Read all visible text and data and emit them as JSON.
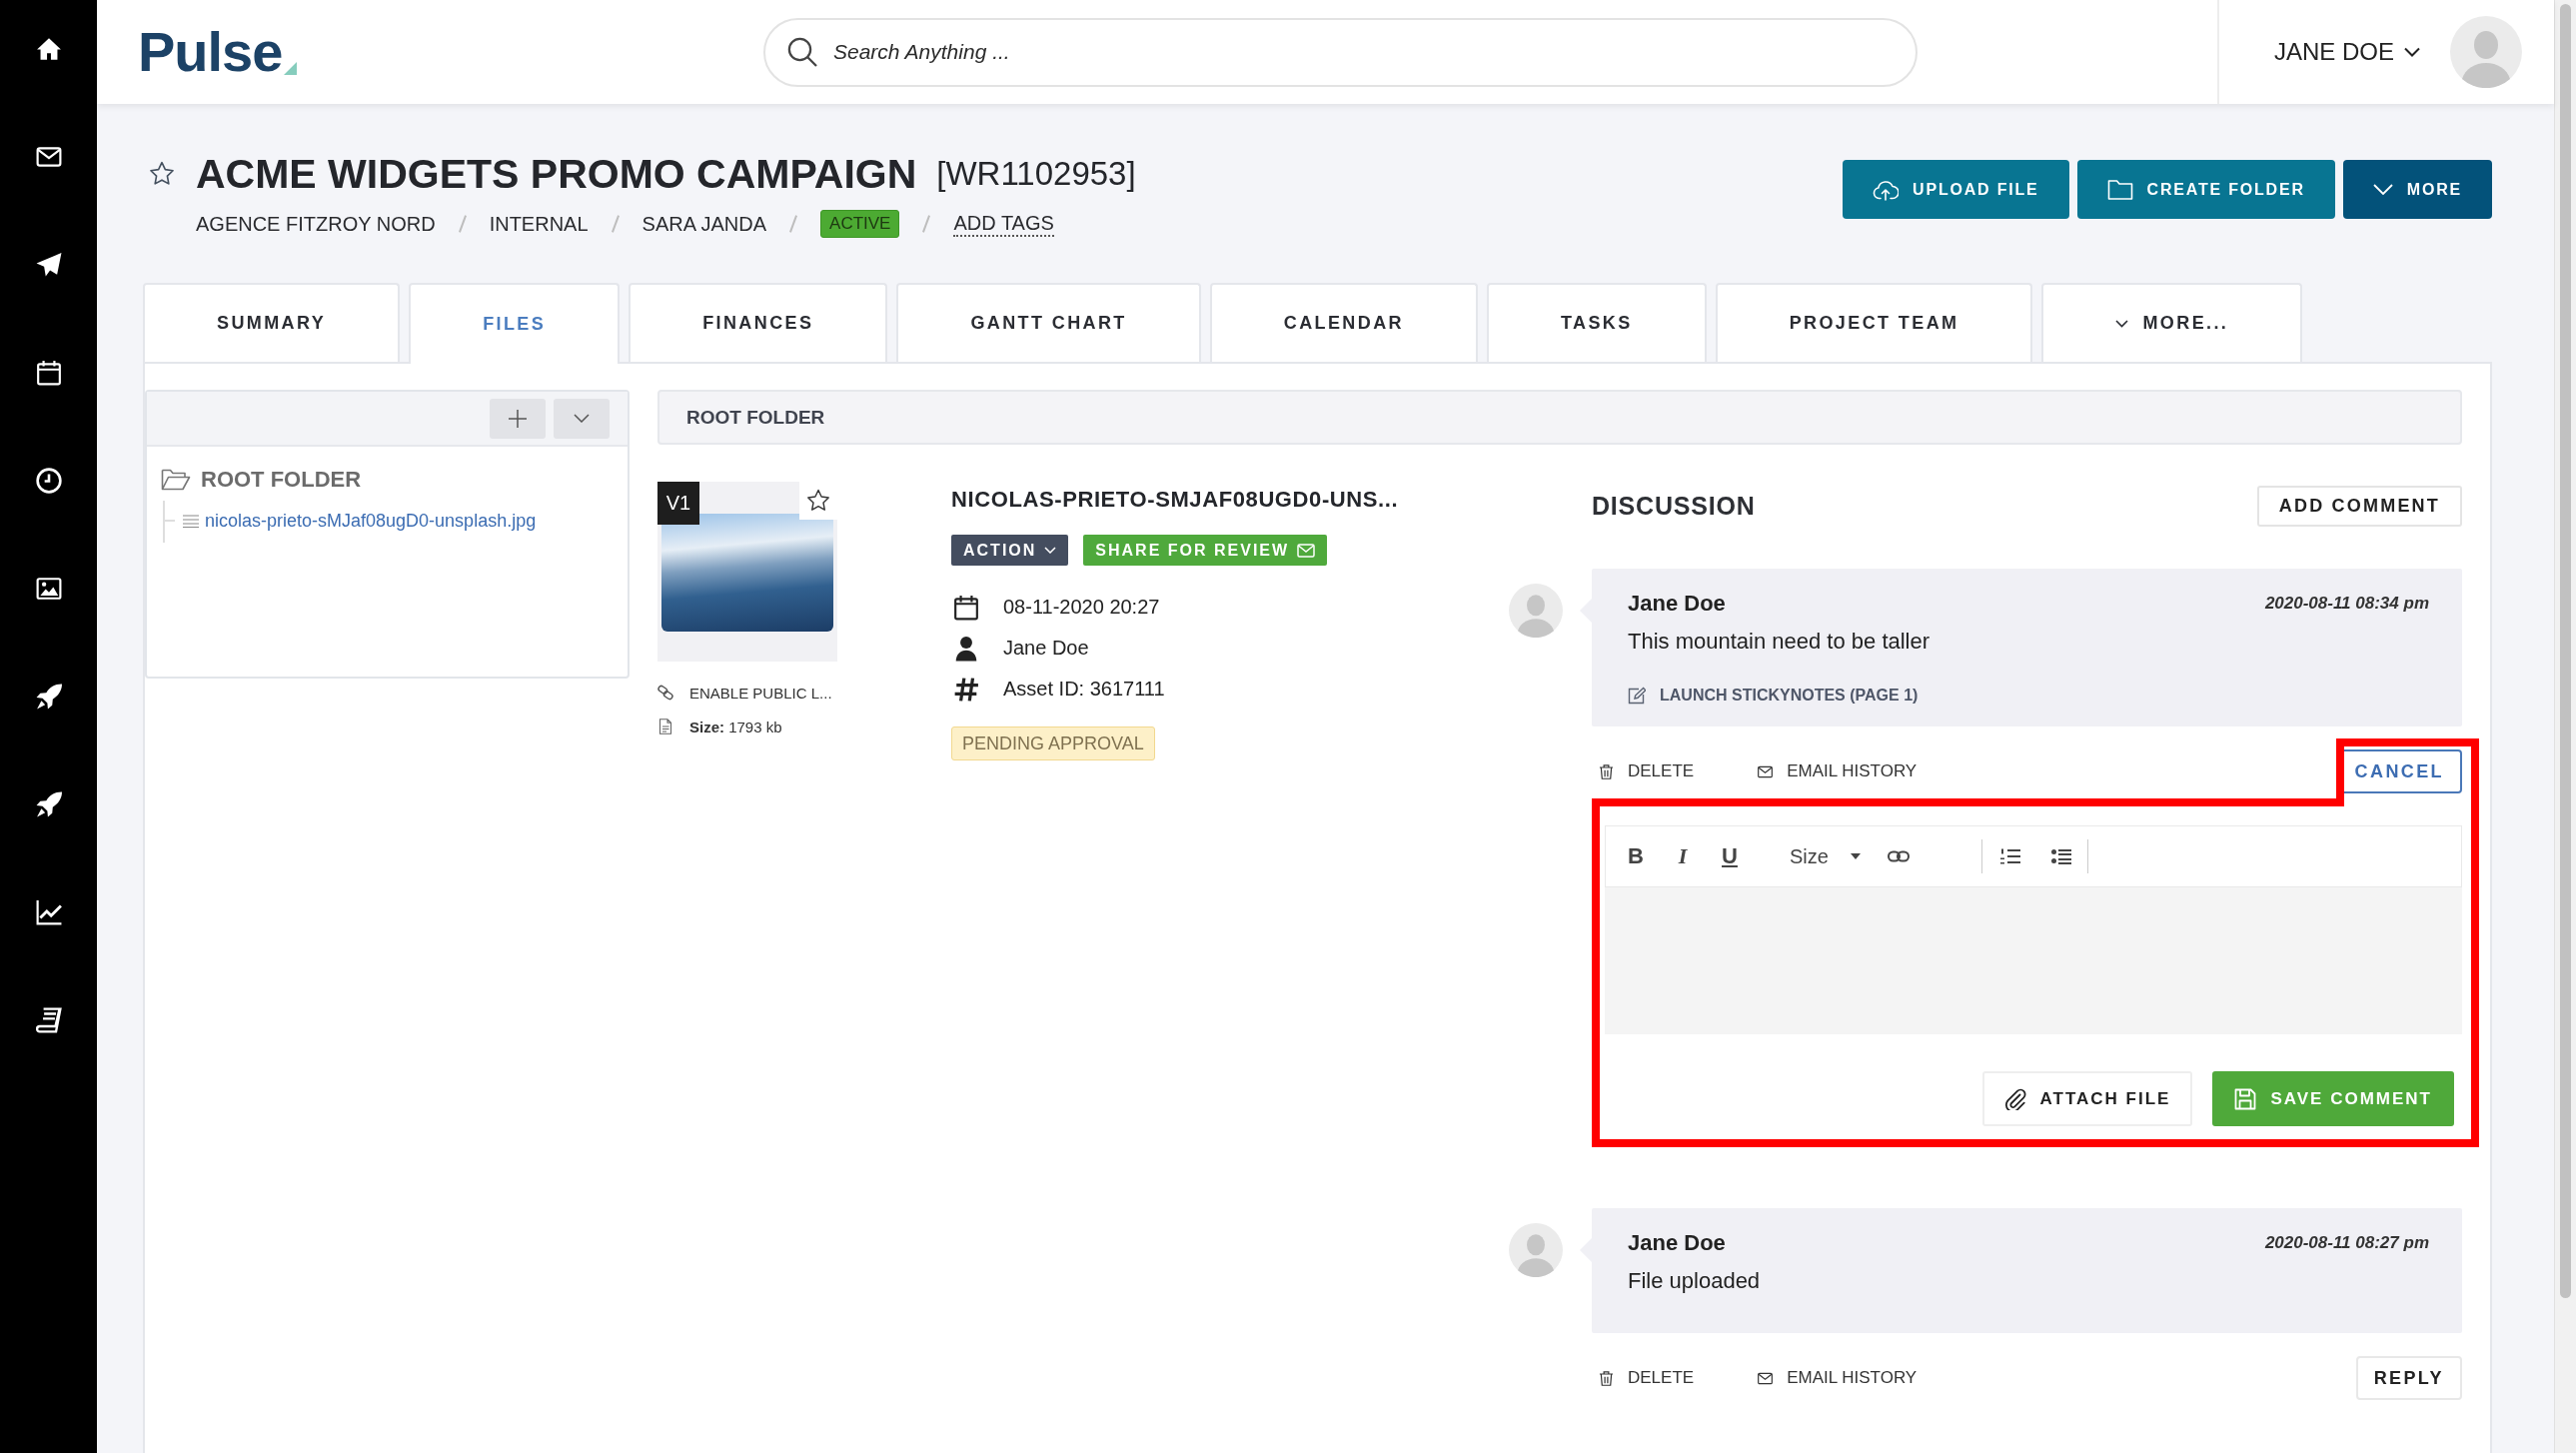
{
  "header": {
    "logo": "Pulse",
    "search": {
      "placeholder": "Search Anything ..."
    },
    "user": {
      "name": "JANE DOE"
    }
  },
  "project": {
    "title": "ACME WIDGETS PROMO CAMPAIGN",
    "code": "[WR1102953]",
    "starred": false,
    "breadcrumb": [
      "AGENCE FITZROY NORD",
      "INTERNAL",
      "SARA JANDA"
    ],
    "status": "ACTIVE",
    "tags_link": "ADD TAGS"
  },
  "actions": [
    {
      "label": "UPLOAD FILE",
      "kind": "upload"
    },
    {
      "label": "CREATE FOLDER",
      "kind": "folder"
    },
    {
      "label": "MORE",
      "kind": "menu"
    }
  ],
  "tabs": [
    {
      "label": "SUMMARY",
      "selected": false,
      "kind": "tab"
    },
    {
      "label": "FILES",
      "selected": true,
      "kind": "tab"
    },
    {
      "label": "FINANCES",
      "selected": false,
      "kind": "tab"
    },
    {
      "label": "GANTT CHART",
      "selected": false,
      "kind": "tab"
    },
    {
      "label": "CALENDAR",
      "selected": false,
      "kind": "tab"
    },
    {
      "label": "TASKS",
      "selected": false,
      "kind": "tab"
    },
    {
      "label": "PROJECT TEAM",
      "selected": false,
      "kind": "tab"
    },
    {
      "label": "MORE...",
      "selected": false,
      "kind": "menu"
    }
  ],
  "folder_tree": {
    "root": {
      "name": "ROOT FOLDER",
      "expanded": true,
      "children": [
        {
          "name": "nicolas-prieto-sMJaf08ugD0-unsplash.jpg"
        }
      ]
    }
  },
  "path_bar": "ROOT FOLDER",
  "file": {
    "version": "V1",
    "starred": false,
    "links": [
      {
        "kind": "link",
        "text": "ENABLE PUBLIC L..."
      },
      {
        "kind": "size",
        "text": "**Size:** 1793 kb"
      }
    ],
    "name": "NICOLAS-PRIETO-SMJAF08UGD0-UNS...",
    "buttons": [
      {
        "label": "ACTION",
        "kind": "dropdown"
      },
      {
        "label": "SHARE FOR REVIEW",
        "kind": "share"
      }
    ],
    "meta": [
      {
        "kind": "date",
        "text": "08-11-2020 20:27"
      },
      {
        "kind": "owner",
        "text": "Jane Doe"
      },
      {
        "kind": "asset",
        "text": "Asset ID: 3617111"
      }
    ],
    "status": "PENDING APPROVAL"
  },
  "discussion": {
    "title": "DISCUSSION",
    "add_button": "ADD COMMENT",
    "comments": [
      {
        "author": "Jane Doe",
        "time": "2020-08-11 08:34 pm",
        "text": "This mountain need to be taller",
        "link": "LAUNCH STICKYNOTES (PAGE 1)",
        "actions": [
          {
            "kind": "delete",
            "label": "DELETE"
          },
          {
            "kind": "email",
            "label": "EMAIL HISTORY"
          }
        ],
        "button": "CANCEL",
        "editing": true
      },
      {
        "author": "Jane Doe",
        "time": "2020-08-11 08:27 pm",
        "text": "File uploaded",
        "actions": [
          {
            "kind": "delete",
            "label": "DELETE"
          },
          {
            "kind": "email",
            "label": "EMAIL HISTORY"
          }
        ],
        "button": "REPLY",
        "editing": false
      }
    ],
    "editor": {
      "highlighted": true,
      "toolbar": [
        {
          "kind": "bold",
          "label": "B"
        },
        {
          "kind": "italic",
          "label": "I"
        },
        {
          "kind": "underline",
          "label": "U"
        },
        {
          "kind": "size",
          "label": "Size"
        },
        {
          "kind": "link"
        },
        {
          "kind": "separator"
        },
        {
          "kind": "ordered-list"
        },
        {
          "kind": "bullet-list"
        },
        {
          "kind": "separator"
        }
      ],
      "buttons": [
        {
          "kind": "attach",
          "label": "ATTACH FILE"
        },
        {
          "kind": "save",
          "label": "SAVE COMMENT"
        }
      ]
    }
  }
}
